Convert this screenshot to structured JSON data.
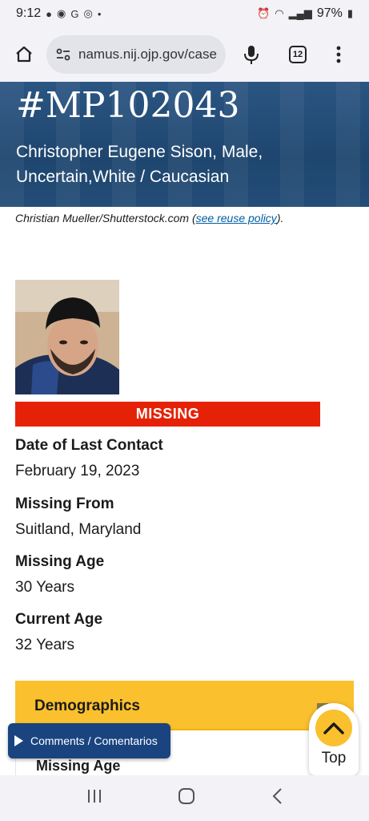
{
  "status_bar": {
    "time": "9:12",
    "battery": "97%"
  },
  "browser": {
    "url": "namus.nij.ojp.gov/case",
    "tab_count": "12"
  },
  "hero": {
    "case_id": "#MP102043",
    "subtitle": "Christopher Eugene Sison, Male, Uncertain,White / Caucasian"
  },
  "credit": {
    "text": "Christian Mueller/Shutterstock.com (",
    "link": "see reuse policy",
    "suffix": ")."
  },
  "case": {
    "status": "MISSING",
    "status_color": "#e52207",
    "fields": [
      {
        "label": "Date of Last Contact",
        "value": "February 19, 2023"
      },
      {
        "label": "Missing From",
        "value": "Suitland, Maryland"
      },
      {
        "label": "Missing Age",
        "value": "30 Years"
      },
      {
        "label": "Current Age",
        "value": "32 Years"
      }
    ]
  },
  "demographics": {
    "label": "Demographics",
    "first_field": "Missing Age",
    "accent": "#fbc02d"
  },
  "floating": {
    "comments_label": "Comments / Comentarios",
    "top_label": "Top"
  },
  "icons": [
    "home-icon",
    "site-settings-icon",
    "mic-icon",
    "tabs-icon",
    "more-vert-icon",
    "play-icon",
    "chevron-up-icon",
    "recents-icon",
    "home-nav-icon",
    "back-icon"
  ]
}
